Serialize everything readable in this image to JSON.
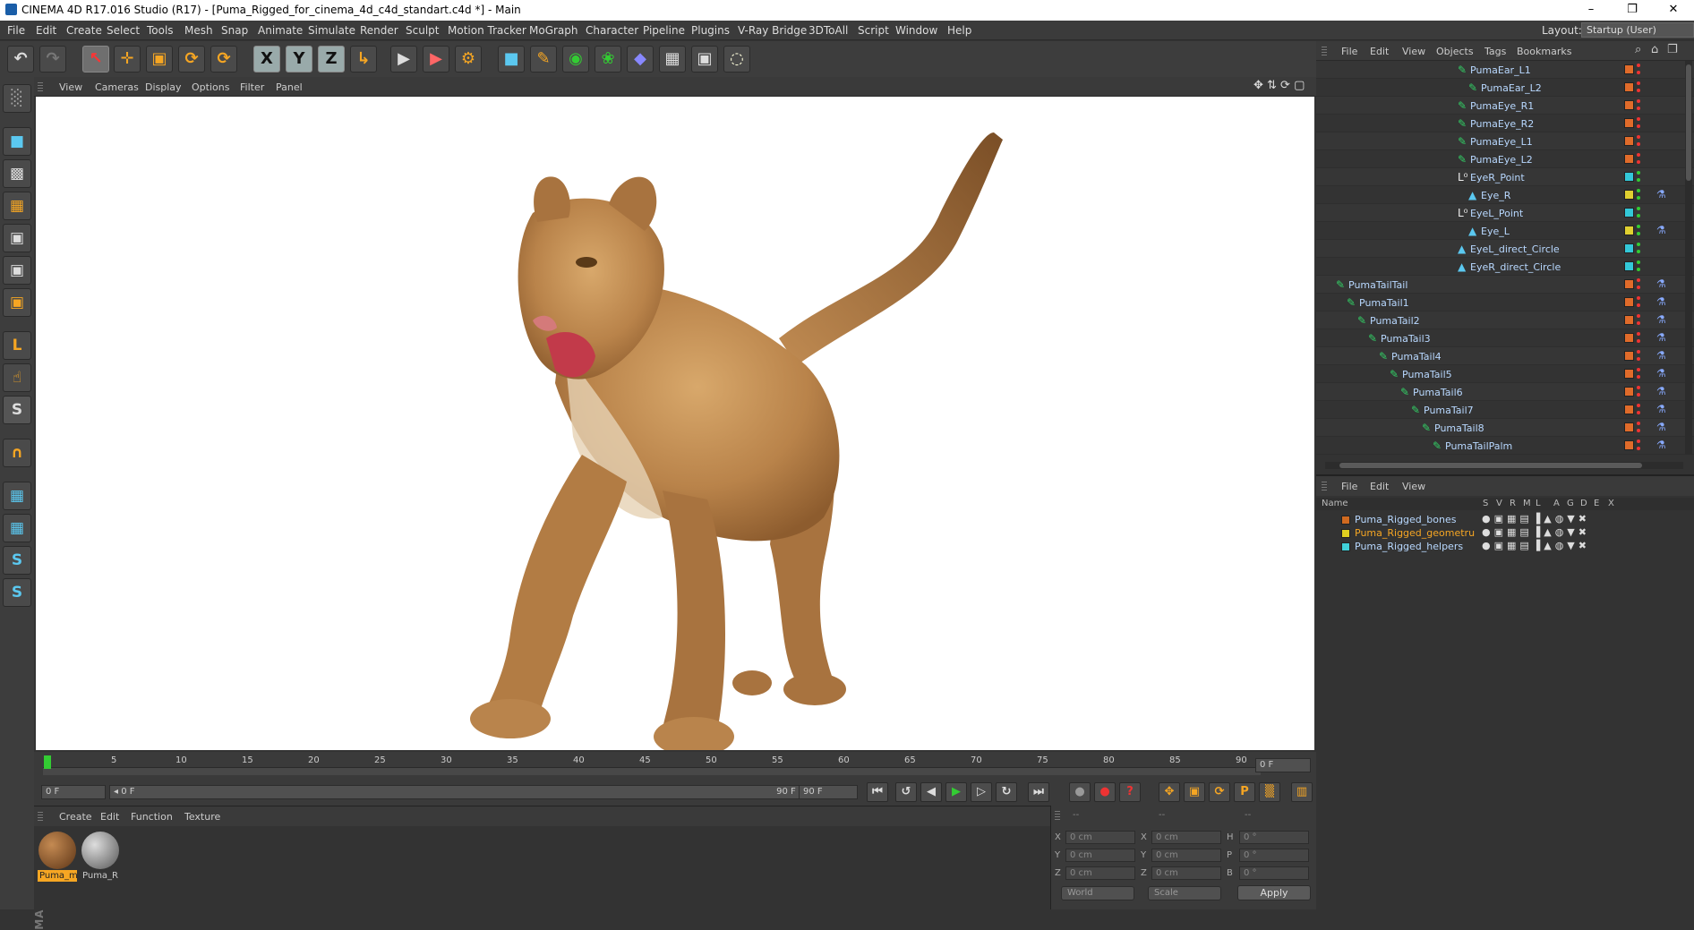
{
  "window": {
    "title": "CINEMA 4D R17.016 Studio (R17) - [Puma_Rigged_for_cinema_4d_c4d_standart.c4d *] - Main",
    "minimize": "–",
    "restore": "❐",
    "close": "✕"
  },
  "menu": [
    "File",
    "Edit",
    "Create",
    "Select",
    "Tools",
    "Mesh",
    "Snap",
    "Animate",
    "Simulate",
    "Render",
    "Sculpt",
    "Motion Tracker",
    "MoGraph",
    "Character",
    "Pipeline",
    "Plugins",
    "V-Ray Bridge",
    "3DToAll",
    "Script",
    "Window",
    "Help"
  ],
  "layout": {
    "label": "Layout:",
    "value": "Startup (User)"
  },
  "toolbar": {
    "undo": "↶",
    "redo": "↷",
    "select": "↖",
    "move": "✛",
    "scale": "▣",
    "rotate": "⟳",
    "recent": "⟳",
    "x": "X",
    "y": "Y",
    "z": "Z",
    "coord": "↳",
    "render_view": "▶",
    "render_pv": "▶",
    "render_settings": "⚙",
    "cube": "■",
    "pen": "✎",
    "subdiv": "◉",
    "array": "❀",
    "deformer": "◆",
    "floor": "▦",
    "camera": "▣",
    "light": "◌"
  },
  "left_tools": [
    "░",
    "■",
    "▩",
    "▦",
    "▣",
    "▣",
    "▣",
    "L",
    "☝",
    "S",
    "∩",
    "▦",
    "▦",
    "S",
    "S"
  ],
  "viewport": {
    "menu": [
      "View",
      "Cameras",
      "Display",
      "Options",
      "Filter",
      "Panel"
    ],
    "nav_icons": "✥ ⇅ ⟳ ▢"
  },
  "timeline": {
    "ticks": [
      "0",
      "5",
      "10",
      "15",
      "20",
      "25",
      "30",
      "35",
      "40",
      "45",
      "50",
      "55",
      "60",
      "65",
      "70",
      "75",
      "80",
      "85",
      "90"
    ],
    "current_frame": "0 F"
  },
  "transport": {
    "start_field": "0 F",
    "range_start": "◂ 0 F",
    "range_end": "90 F ▸",
    "end_field": "90 F",
    "buttons": [
      "⏮",
      "↺",
      "◀",
      "▶",
      "▷",
      "↻",
      "⏭"
    ],
    "key_buttons": [
      "●",
      "●",
      "?"
    ],
    "tool_buttons": [
      "✥",
      "▣",
      "⟳",
      "P",
      "▒",
      "▥"
    ]
  },
  "materials": {
    "menu": [
      "Create",
      "Edit",
      "Function",
      "Texture"
    ],
    "items": [
      {
        "label": "Puma_m",
        "color": "#8a5a2b",
        "selected": true
      },
      {
        "label": "Puma_R",
        "color": "#9a9a9a",
        "selected": false
      }
    ]
  },
  "coords": {
    "rows": [
      {
        "a": "X",
        "av": "0 cm",
        "b": "X",
        "bv": "0 cm",
        "c": "H",
        "cv": "0 °"
      },
      {
        "a": "Y",
        "av": "0 cm",
        "b": "Y",
        "bv": "0 cm",
        "c": "P",
        "cv": "0 °"
      },
      {
        "a": "Z",
        "av": "0 cm",
        "b": "Z",
        "bv": "0 cm",
        "c": "B",
        "cv": "0 °"
      }
    ],
    "mode": "World",
    "size": "Scale",
    "apply": "Apply",
    "dashes": "--"
  },
  "object_manager": {
    "menu": [
      "File",
      "Edit",
      "View",
      "Objects",
      "Tags",
      "Bookmarks"
    ],
    "rows": [
      {
        "name": "PumaEar_L1",
        "tag": "#e06b2a"
      },
      {
        "name": "PumaEar_L2",
        "tag": "#e06b2a"
      },
      {
        "name": "PumaEye_R1",
        "tag": "#e06b2a"
      },
      {
        "name": "PumaEye_R2",
        "tag": "#e06b2a"
      },
      {
        "name": "PumaEye_L1",
        "tag": "#e06b2a"
      },
      {
        "name": "PumaEye_L2",
        "tag": "#e06b2a"
      },
      {
        "name": "EyeR_Point",
        "tag": "#33c8d8"
      },
      {
        "name": "Eye_R",
        "tag": "#e0d030"
      },
      {
        "name": "EyeL_Point",
        "tag": "#33c8d8"
      },
      {
        "name": "Eye_L",
        "tag": "#e0d030"
      },
      {
        "name": "EyeL_direct_Circle",
        "tag": "#33c8d8"
      },
      {
        "name": "EyeR_direct_Circle",
        "tag": "#33c8d8"
      },
      {
        "name": "PumaTailTail",
        "tag": "#e06b2a"
      },
      {
        "name": "PumaTail1",
        "tag": "#e06b2a"
      },
      {
        "name": "PumaTail2",
        "tag": "#e06b2a"
      },
      {
        "name": "PumaTail3",
        "tag": "#e06b2a"
      },
      {
        "name": "PumaTail4",
        "tag": "#e06b2a"
      },
      {
        "name": "PumaTail5",
        "tag": "#e06b2a"
      },
      {
        "name": "PumaTail6",
        "tag": "#e06b2a"
      },
      {
        "name": "PumaTail7",
        "tag": "#e06b2a"
      },
      {
        "name": "PumaTail8",
        "tag": "#e06b2a"
      },
      {
        "name": "PumaTailPalm",
        "tag": "#e06b2a"
      }
    ]
  },
  "layer_manager": {
    "menu": [
      "File",
      "Edit",
      "View"
    ],
    "columns": [
      "Name",
      "S",
      "V",
      "R",
      "M",
      "L",
      "A",
      "G",
      "D",
      "E",
      "X"
    ],
    "layers": [
      {
        "name": "Puma_Rigged_bones",
        "color": "#d06a20",
        "active": false
      },
      {
        "name": "Puma_Rigged_geometru",
        "color": "#e0d020",
        "active": true
      },
      {
        "name": "Puma_Rigged_helpers",
        "color": "#40d0d8",
        "active": false
      }
    ],
    "icons": "●▣▦▤▐▲◍▼✖"
  },
  "colors": {
    "accent_orange": "#f6a623",
    "selection": "#f6a623"
  }
}
